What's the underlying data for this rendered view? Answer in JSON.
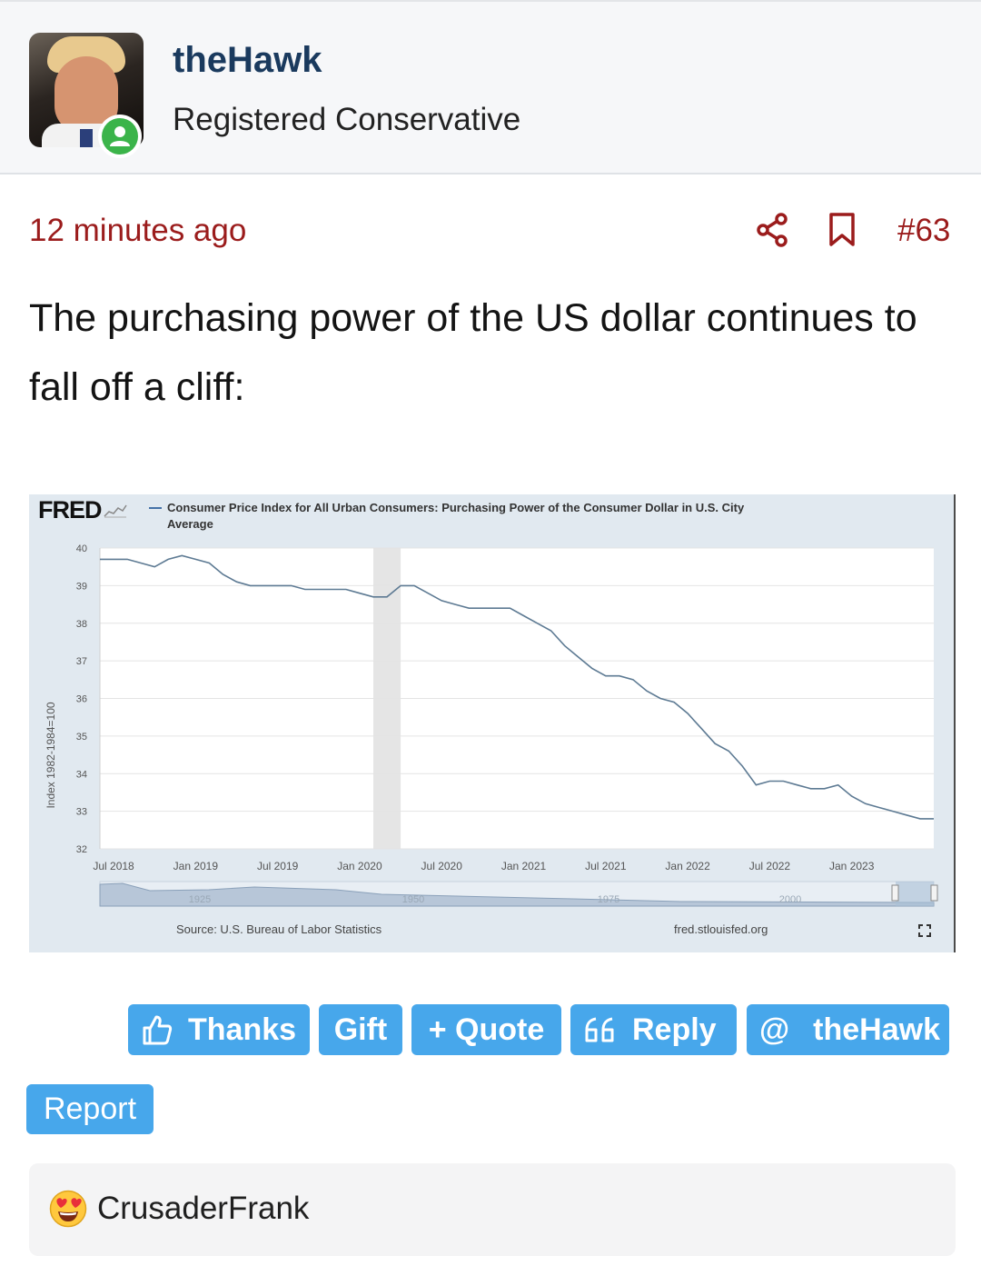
{
  "post": {
    "author": {
      "name": "theHawk",
      "title": "Registered Conservative",
      "avatar_icon": "avatar-photo",
      "status_icon": "online-user-icon"
    },
    "time": "12 minutes ago",
    "number": "#63",
    "text": "The purchasing power of the US dollar continues to fall off a cliff:"
  },
  "chart": {
    "logo": "FRED",
    "title_line1": "Consumer Price Index for All Urban Consumers: Purchasing Power of the Consumer Dollar in U.S. City",
    "title_line2": "Average",
    "ylabel": "Index 1982-1984=100",
    "source": "Source: U.S. Bureau of Labor Statistics",
    "site": "fred.stlouisfed.org",
    "navigator_labels": [
      "1925",
      "1950",
      "1975",
      "2000"
    ]
  },
  "chart_data": {
    "type": "line",
    "title": "Consumer Price Index for All Urban Consumers: Purchasing Power of the Consumer Dollar in U.S. City Average",
    "ylabel": "Index 1982-1984=100",
    "xlabel": "",
    "ylim": [
      32,
      40
    ],
    "y_ticks": [
      "32",
      "33",
      "34",
      "35",
      "36",
      "37",
      "38",
      "39",
      "40"
    ],
    "x_ticks": [
      "Jul 2018",
      "Jan 2019",
      "Jul 2019",
      "Jan 2020",
      "Jul 2020",
      "Jan 2021",
      "Jul 2021",
      "Jan 2022",
      "Jul 2022",
      "Jan 2023"
    ],
    "recession_shading": [
      "Feb 2020",
      "Apr 2020"
    ],
    "grid": true,
    "series": [
      {
        "x": [
          "Jun 2018",
          "Jul 2018",
          "Aug 2018",
          "Sep 2018",
          "Oct 2018",
          "Nov 2018",
          "Dec 2018",
          "Jan 2019",
          "Feb 2019",
          "Mar 2019",
          "Apr 2019",
          "May 2019",
          "Jun 2019",
          "Jul 2019",
          "Aug 2019",
          "Sep 2019",
          "Oct 2019",
          "Nov 2019",
          "Dec 2019",
          "Jan 2020",
          "Feb 2020",
          "Mar 2020",
          "Apr 2020",
          "May 2020",
          "Jun 2020",
          "Jul 2020",
          "Aug 2020",
          "Sep 2020",
          "Oct 2020",
          "Nov 2020",
          "Dec 2020",
          "Jan 2021",
          "Feb 2021",
          "Mar 2021",
          "Apr 2021",
          "May 2021",
          "Jun 2021",
          "Jul 2021",
          "Aug 2021",
          "Sep 2021",
          "Oct 2021",
          "Nov 2021",
          "Dec 2021",
          "Jan 2022",
          "Feb 2022",
          "Mar 2022",
          "Apr 2022",
          "May 2022",
          "Jun 2022",
          "Jul 2022",
          "Aug 2022",
          "Sep 2022",
          "Oct 2022",
          "Nov 2022",
          "Dec 2022",
          "Jan 2023",
          "Feb 2023",
          "Mar 2023",
          "Apr 2023",
          "May 2023",
          "Jun 2023",
          "Jul 2023"
        ],
        "values": [
          39.7,
          39.7,
          39.7,
          39.6,
          39.5,
          39.7,
          39.8,
          39.7,
          39.6,
          39.3,
          39.1,
          39.0,
          39.0,
          39.0,
          39.0,
          38.9,
          38.9,
          38.9,
          38.9,
          38.8,
          38.7,
          38.7,
          39.0,
          39.0,
          38.8,
          38.6,
          38.5,
          38.4,
          38.4,
          38.4,
          38.4,
          38.2,
          38.0,
          37.8,
          37.4,
          37.1,
          36.8,
          36.6,
          36.6,
          36.5,
          36.2,
          36.0,
          35.9,
          35.6,
          35.2,
          34.8,
          34.6,
          34.2,
          33.7,
          33.8,
          33.8,
          33.7,
          33.6,
          33.6,
          33.7,
          33.4,
          33.2,
          33.1,
          33.0,
          32.9,
          32.8,
          32.8
        ]
      }
    ]
  },
  "buttons": {
    "thanks": "Thanks",
    "gift": "Gift",
    "quote": "+ Quote",
    "reply": "Reply",
    "mention": "theHawk",
    "report": "Report"
  },
  "reactions": [
    {
      "icon": "heart-eyes-emoji-icon",
      "user": "CrusaderFrank"
    }
  ],
  "colors": {
    "accent": "#47a7eb",
    "meta_red": "#9b1c1c",
    "username_blue": "#1a3a5e",
    "series_line": "#5d7a93"
  }
}
